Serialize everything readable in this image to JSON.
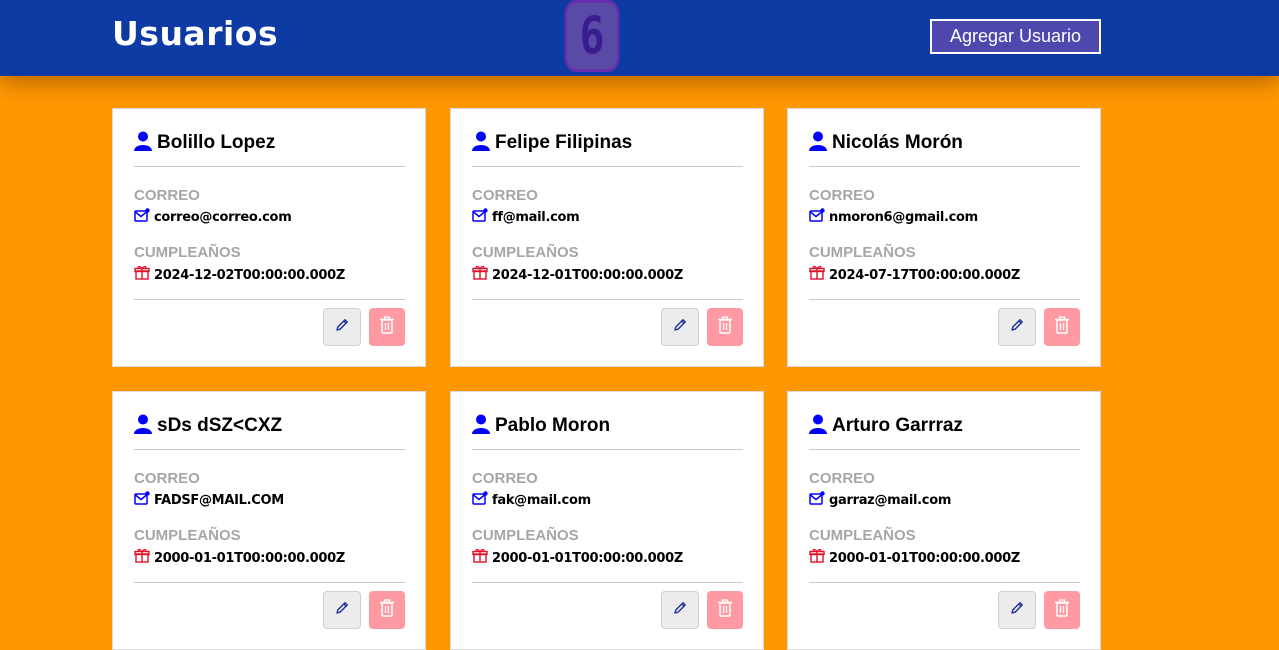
{
  "header": {
    "title": "Usuarios",
    "user_count": "6",
    "add_button_label": "Agregar Usuario"
  },
  "labels": {
    "email": "CORREO",
    "birthday": "CUMPLEAÑOS"
  },
  "users": [
    {
      "name": "Bolillo Lopez",
      "email": "correo@correo.com",
      "birthday": "2024-12-02T00:00:00.000Z"
    },
    {
      "name": "Felipe Filipinas",
      "email": "ff@mail.com",
      "birthday": "2024-12-01T00:00:00.000Z"
    },
    {
      "name": "Nicolás Morón",
      "email": "nmoron6@gmail.com",
      "birthday": "2024-07-17T00:00:00.000Z"
    },
    {
      "name": "sDs dSZ<CXZ",
      "email": "FADSF@MAIL.COM",
      "birthday": "2000-01-01T00:00:00.000Z"
    },
    {
      "name": "Pablo Moron",
      "email": "fak@mail.com",
      "birthday": "2000-01-01T00:00:00.000Z"
    },
    {
      "name": "Arturo Garrraz",
      "email": "garraz@mail.com",
      "birthday": "2000-01-01T00:00:00.000Z"
    }
  ],
  "icons": {
    "user": "user-icon",
    "email": "mail-icon",
    "birthday": "gift-icon",
    "edit": "pencil-icon",
    "delete": "trash-icon"
  },
  "colors": {
    "header_bg": "#0d3ba3",
    "page_bg": "#ff9800",
    "badge_bg": "#5a4aa8",
    "user_icon": "#0000ff",
    "gift_icon": "#e0102a",
    "delete_bg": "#ff9aa2"
  }
}
